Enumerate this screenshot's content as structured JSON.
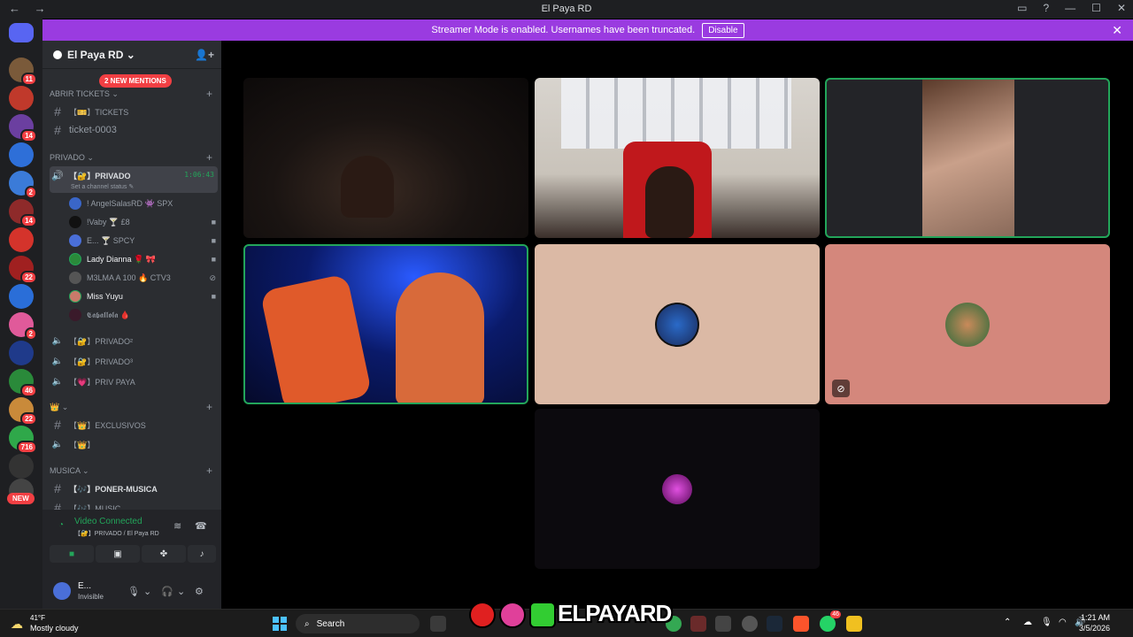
{
  "window": {
    "title": "El Paya RD",
    "back": "←",
    "forward": "→",
    "controls": [
      "▭",
      "?",
      "—",
      "☐",
      "✕"
    ]
  },
  "banner": {
    "message": "Streamer Mode is enabled. Usernames have been truncated.",
    "disable_label": "Disable",
    "close": "✕"
  },
  "guilds": {
    "badges": [
      "11",
      "14",
      "2",
      "14",
      "22",
      "2",
      "46",
      "22",
      "716"
    ],
    "new_label": "NEW"
  },
  "sidebar": {
    "server_name": "El Paya RD ⌄",
    "mentions": "2 NEW MENTIONS",
    "categories": {
      "tickets": "ABRIR TICKETS ⌄",
      "privado": "Privado ⌄",
      "exclusivos": "👑 ⌄",
      "musica": "MUSICA ⌄"
    },
    "channels": {
      "tickets": "【🎫】TICKETS",
      "ticket_0003": "ticket-0003",
      "privado": "【🔐】PRIVADO",
      "privado_status": "Set a channel status ✎",
      "privado_timer": "1:06:43",
      "privado2": "【🔐】PRIVADO²",
      "privado3": "【🔐】PRIVADO³",
      "priv_paya": "【💗】PRIV PAYA",
      "exclusivos": "【👑】EXCLUSIVOS",
      "exclusivos_voice": "【👑】",
      "poner_musica": "【🎶】PONER-MUSICA",
      "music": "【🎶】MUSIC"
    },
    "users": [
      {
        "name": "! AngelSalasRD",
        "tag": "👾 SPX"
      },
      {
        "name": "!Vaby",
        "tag": "🍸 £8"
      },
      {
        "name": "E...",
        "tag": "🍸 SPCY"
      },
      {
        "name": "Lady Dianna",
        "tag": "🌹 🎀"
      },
      {
        "name": "M3LMA A 100",
        "tag": "🔥 CTV3"
      },
      {
        "name": "Miss Yuyu",
        "tag": ""
      },
      {
        "name": "𝕮𝖆𝖇𝖆𝖑𝖑𝖔𝖑𝖆",
        "tag": "🩸"
      }
    ],
    "voice": {
      "title": "Video Connected",
      "subtitle": "【🔐】PRIVADO / El Paya RD"
    },
    "user": {
      "name": "E...",
      "status": "Invisible"
    }
  },
  "stage": {
    "logo_text": "ELPAYARD"
  },
  "taskbar": {
    "temperature": "41°F",
    "weather": "Mostly cloudy",
    "search_placeholder": "Search",
    "time": "1:21 AM",
    "date": "3/5/2026",
    "whatsapp_badge": "46"
  },
  "colors": {
    "accent_purple": "#9a3be0",
    "speaking_green": "#23a55a",
    "badge_red": "#f23f43"
  }
}
